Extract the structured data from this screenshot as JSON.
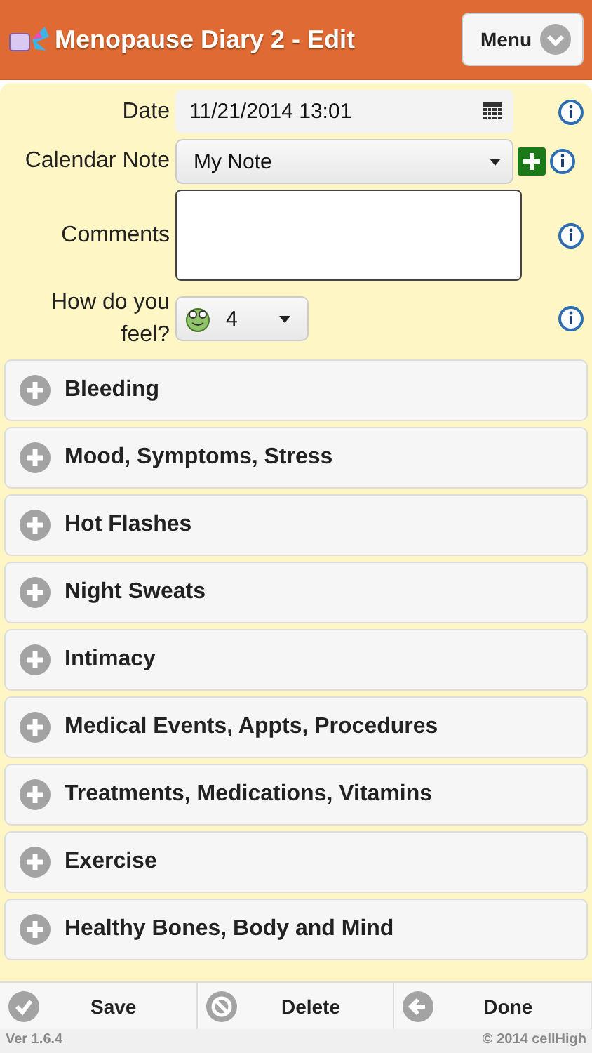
{
  "header": {
    "title": "Menopause Diary 2 - Edit",
    "menu_button": "Menu"
  },
  "form": {
    "date": {
      "label": "Date",
      "value": "11/21/2014 13:01"
    },
    "calendar_note": {
      "label": "Calendar Note",
      "value": "My Note"
    },
    "comments": {
      "label": "Comments"
    },
    "feel": {
      "label": "How do you feel?",
      "value": "4"
    }
  },
  "sections": [
    {
      "title": "Bleeding",
      "expanded": false
    },
    {
      "title": "Mood, Symptoms, Stress",
      "expanded": false
    },
    {
      "title": "Hot Flashes",
      "expanded": false
    },
    {
      "title": "Night Sweats",
      "expanded": false
    },
    {
      "title": "Intimacy",
      "expanded": false
    },
    {
      "title": "Medical Events, Appts, Procedures",
      "expanded": false
    },
    {
      "title": "Treatments, Medications, Vitamins",
      "expanded": false
    },
    {
      "title": "Exercise",
      "expanded": false
    },
    {
      "title": "Healthy Bones, Body and Mind",
      "expanded": false
    }
  ],
  "toolbar": [
    {
      "label": "Save",
      "kind": "check"
    },
    {
      "label": "Delete",
      "kind": "cancel"
    },
    {
      "label": "Done",
      "kind": "back"
    }
  ],
  "footer": {
    "version": "Ver 1.6.4",
    "copyright": "© 2014 cellHigh"
  }
}
